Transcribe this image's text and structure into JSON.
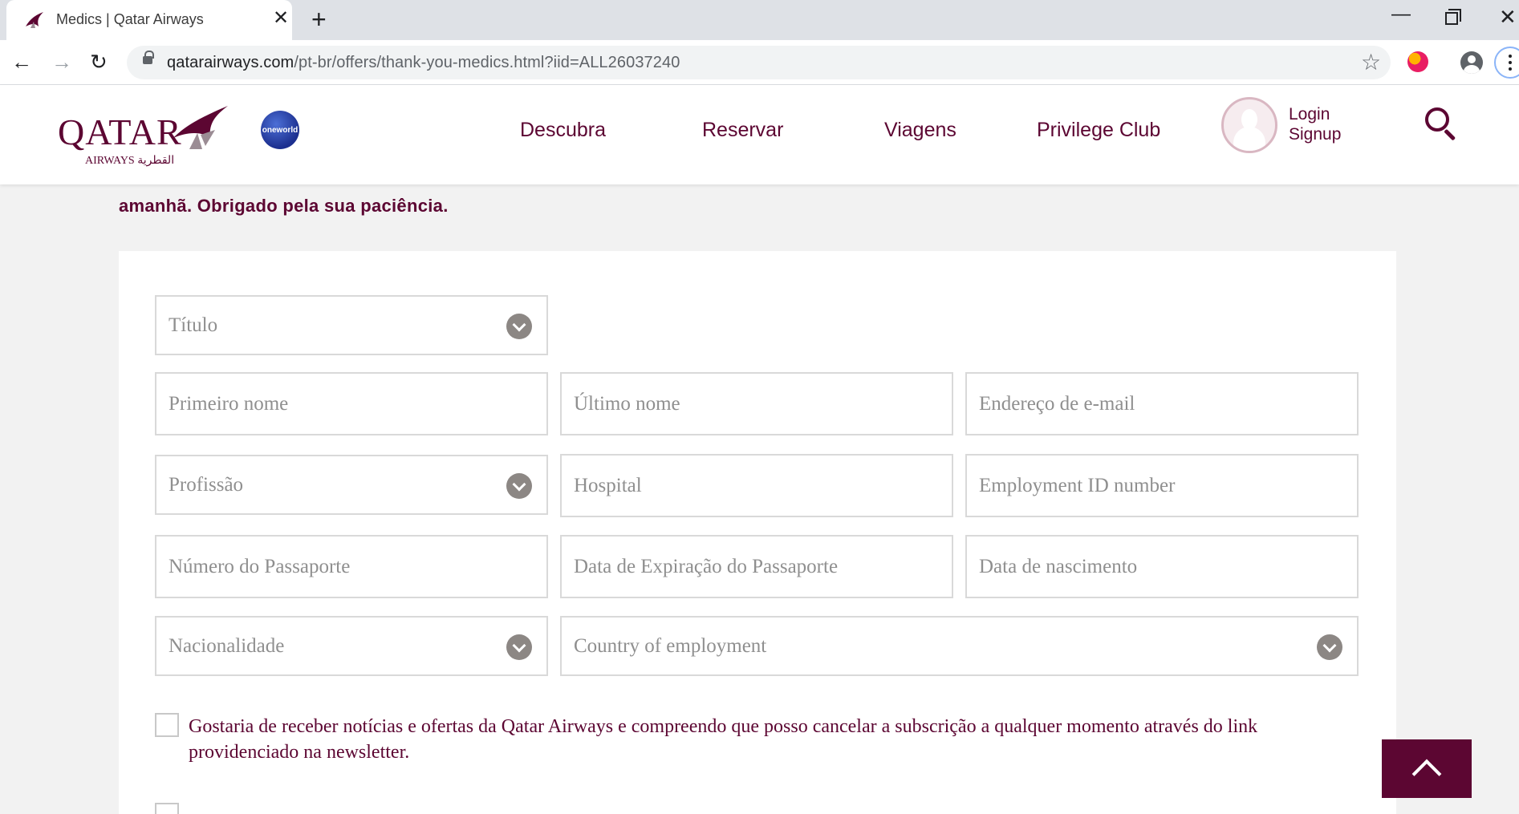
{
  "browser": {
    "tab_title": "Medics | Qatar Airways",
    "tab_close": "✕",
    "new_tab": "+",
    "url_host": "qatarairways.com",
    "url_path": "/pt-br/offers/thank-you-medics.html?iid=ALL26037240",
    "back": "←",
    "forward": "→",
    "reload": "↻",
    "star": "☆",
    "win_min": "—",
    "win_close": "✕"
  },
  "header": {
    "logo_word": "QATAR",
    "logo_sub": "AIRWAYS القطرية",
    "alliance": "oneworld",
    "nav": [
      "Descubra",
      "Reservar",
      "Viagens",
      "Privilege Club"
    ],
    "login": "Login",
    "signup": "Signup"
  },
  "intro": {
    "text": "amanhã. Obrigado pela sua paciência."
  },
  "form": {
    "titulo": "Título",
    "primeiro_nome": "Primeiro nome",
    "ultimo_nome": "Último nome",
    "email": "Endereço de e-mail",
    "profissao": "Profissão",
    "hospital": "Hospital",
    "employment_id": "Employment ID number",
    "passaporte": "Número do Passaporte",
    "expiracao": "Data de Expiração do Passaporte",
    "nascimento": "Data de nascimento",
    "nacionalidade": "Nacionalidade",
    "country_employment": "Country of employment",
    "newsletter_consent": "Gostaria de receber notícias e ofertas da Qatar Airways e compreendo que posso cancelar a subscrição a qualquer momento através do link providenciado na newsletter."
  },
  "colors": {
    "brand": "#5c0632",
    "field_border": "#d9d9d9",
    "placeholder": "#8f8f8f",
    "chevron": "#8c8784"
  }
}
